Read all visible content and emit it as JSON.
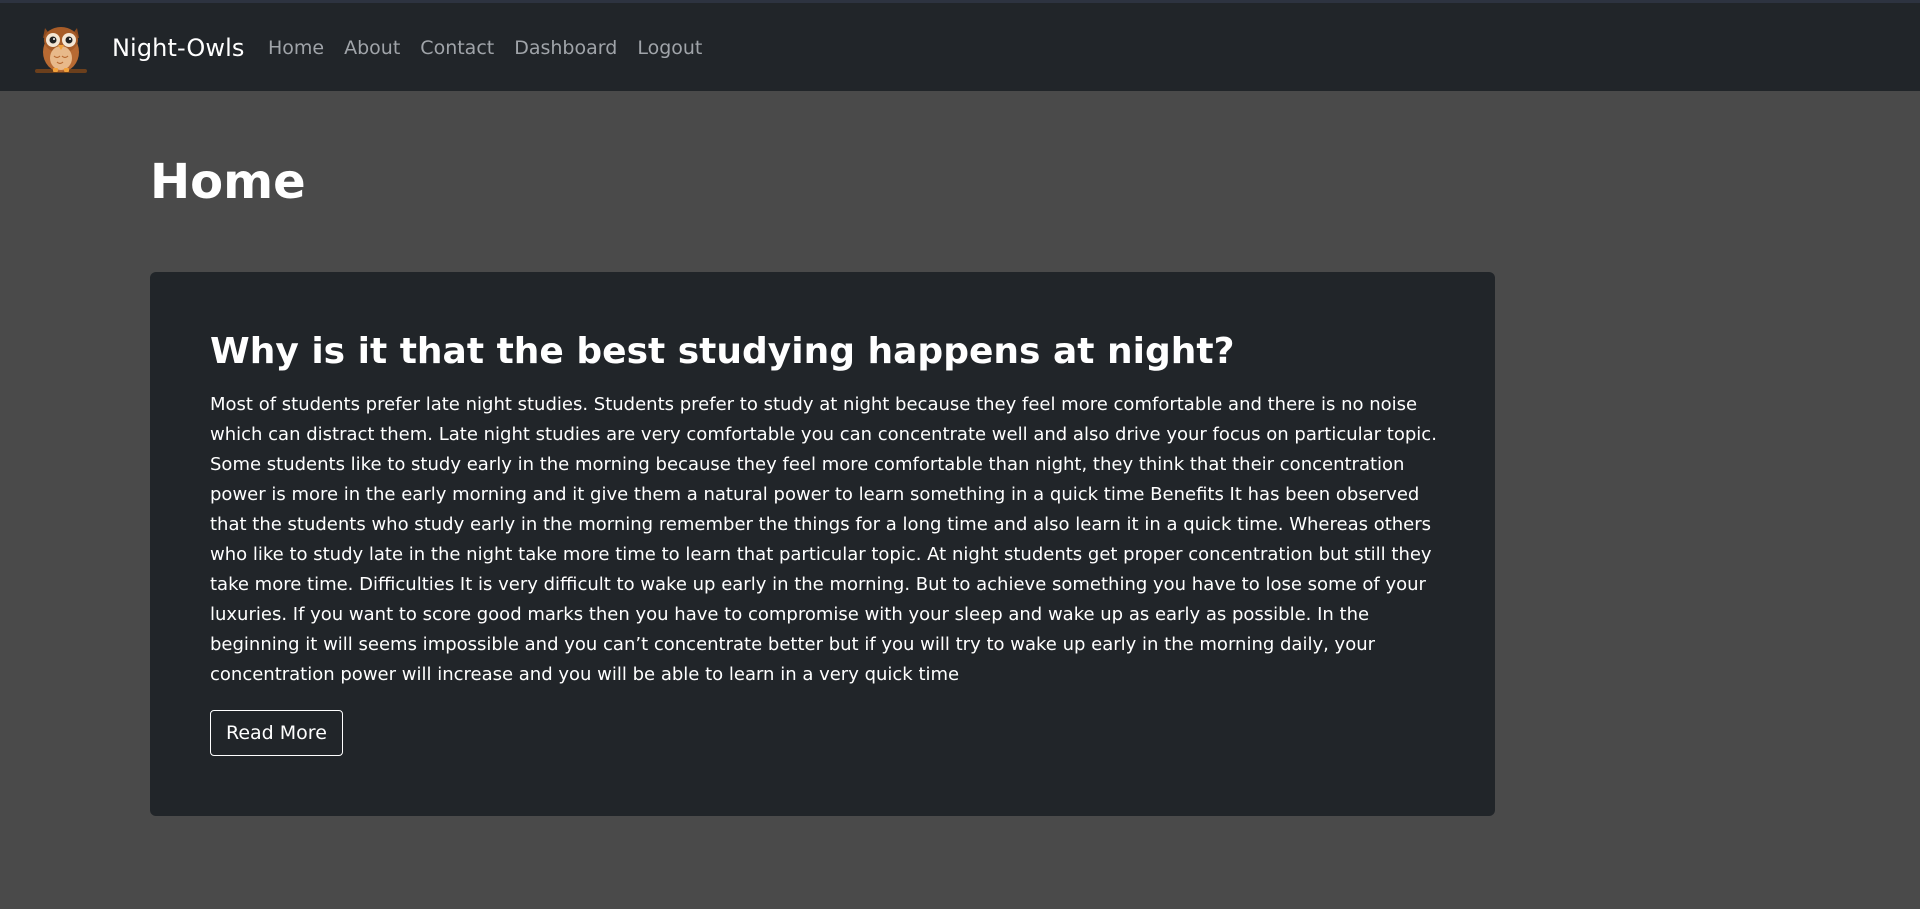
{
  "app": {
    "brand_name": "Night-Owls",
    "logo_icon": "owl-icon",
    "colors": {
      "navbar_bg": "#212529",
      "page_bg": "#4a4a4a",
      "card_bg": "#212529",
      "nav_link": "#a0a4a9",
      "text": "#ffffff"
    }
  },
  "nav": {
    "items": [
      {
        "label": "Home"
      },
      {
        "label": "About"
      },
      {
        "label": "Contact"
      },
      {
        "label": "Dashboard"
      },
      {
        "label": "Logout"
      }
    ]
  },
  "page": {
    "title": "Home"
  },
  "article": {
    "title": "Why is it that the best studying happens at night?",
    "body": "Most of students prefer late night studies. Students prefer to study at night because they feel more comfortable and there is no noise which can distract them. Late night studies are very comfortable you can concentrate well and also drive your focus on particular topic. Some students like to study early in the morning because they feel more comfortable than night, they think that their concentration power is more in the early morning and it give them a natural power to learn something in a quick time Benefits It has been observed that the students who study early in the morning remember the things for a long time and also learn it in a quick time. Whereas others who like to study late in the night take more time to learn that particular topic. At night students get proper concentration but still they take more time. Difficulties It is very difficult to wake up early in the morning. But to achieve something you have to lose some of your luxuries. If you want to score good marks then you have to compromise with your sleep and wake up as early as possible. In the beginning it will seems impossible and you can’t concentrate better but if you will try to wake up early in the morning daily, your concentration power will increase and you will be able to learn in a very quick time",
    "read_more_label": "Read More"
  }
}
